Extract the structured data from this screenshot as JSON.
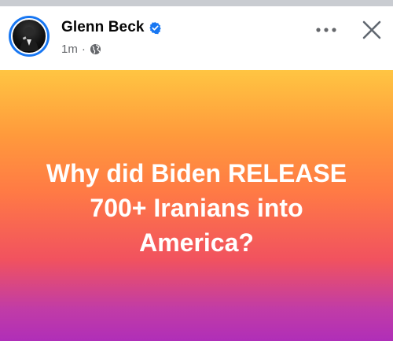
{
  "post": {
    "author": "Glenn Beck",
    "timestamp": "1m",
    "separator": "·",
    "audience_icon": "globe-icon",
    "verified_icon": "verified-badge-icon",
    "avatar_icon": "profile-avatar",
    "text_lines": [
      "Why did Biden RELEASE",
      "700+ Iranians into",
      "America?"
    ],
    "background_gradient": [
      "#ffc542",
      "#ff7a45",
      "#f1525f",
      "#b02eb8"
    ],
    "text_color": "#ffffff"
  },
  "controls": {
    "more_icon": "more-options-icon",
    "close_icon": "close-icon"
  },
  "colors": {
    "verified": "#1877f2",
    "name": "#050505",
    "meta": "#65676b",
    "top_strip": "#c9ccd1"
  }
}
